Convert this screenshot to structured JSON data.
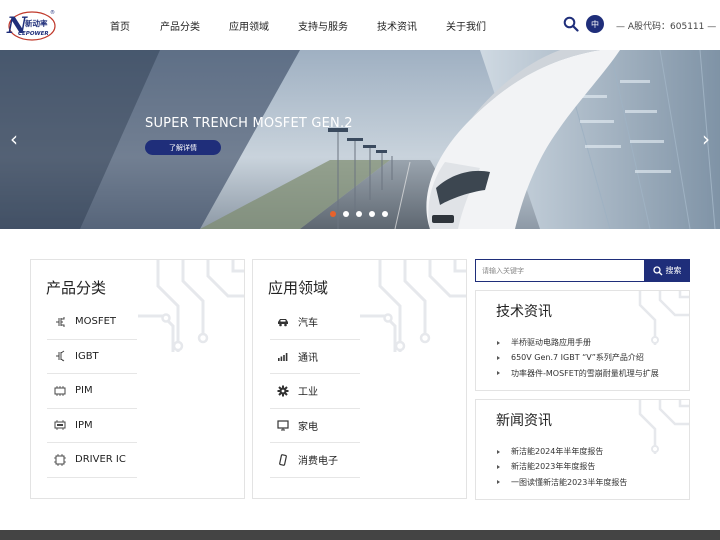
{
  "brand": {
    "logo_text": "新动率",
    "logo_subtext": "CEPOWER",
    "logo_mark": "N",
    "registered_mark": "®",
    "accent_color": "#1f2e7a",
    "highlight_color": "#e8622b"
  },
  "nav": {
    "items": [
      {
        "label": "首页"
      },
      {
        "label": "产品分类"
      },
      {
        "label": "应用领域"
      },
      {
        "label": "支持与服务"
      },
      {
        "label": "技术资讯"
      },
      {
        "label": "关于我们"
      }
    ],
    "search_icon": "search-icon",
    "lang_label": "中",
    "stock_label": "— A股代码：605111 —"
  },
  "banner": {
    "title": "SUPER TRENCH MOSFET GEN.2",
    "button_label": "了解详情",
    "prev_icon": "chevron-left-icon",
    "next_icon": "chevron-right-icon",
    "prev_glyph": "‹",
    "next_glyph": "›",
    "slide_count": 5,
    "active_slide": 1
  },
  "products": {
    "title": "产品分类",
    "items": [
      {
        "label": "MOSFET",
        "icon": "mosfet-icon"
      },
      {
        "label": "IGBT",
        "icon": "igbt-icon"
      },
      {
        "label": "PIM",
        "icon": "pim-module-icon"
      },
      {
        "label": "IPM",
        "icon": "ipm-module-icon"
      },
      {
        "label": "DRIVER IC",
        "icon": "chip-icon"
      }
    ]
  },
  "applications": {
    "title": "应用领域",
    "items": [
      {
        "label": "汽车",
        "icon": "car-icon"
      },
      {
        "label": "通讯",
        "icon": "signal-icon"
      },
      {
        "label": "工业",
        "icon": "gear-icon"
      },
      {
        "label": "家电",
        "icon": "monitor-icon"
      },
      {
        "label": "消费电子",
        "icon": "phone-icon"
      }
    ]
  },
  "search": {
    "placeholder": "请输入关键字",
    "button_label": "搜索"
  },
  "tech_news": {
    "title": "技术资讯",
    "items": [
      {
        "label": "半桥驱动电路应用手册"
      },
      {
        "label": "650V Gen.7 IGBT “V”系列产品介绍"
      },
      {
        "label": "功率器件-MOSFET的雪崩耐量机理与扩展"
      }
    ]
  },
  "company_news": {
    "title": "新闻资讯",
    "items": [
      {
        "label": "新洁能2024年半年度报告"
      },
      {
        "label": "新洁能2023年年度报告"
      },
      {
        "label": "一图读懂新洁能2023半年度报告"
      }
    ]
  }
}
